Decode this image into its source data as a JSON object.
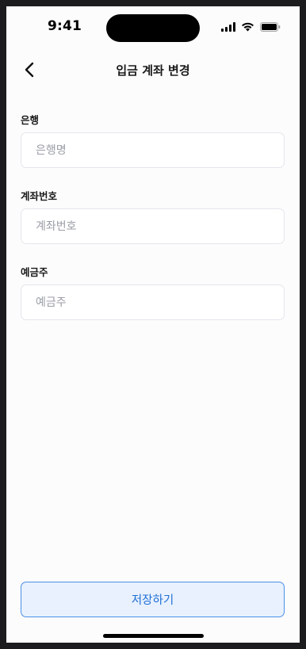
{
  "status_bar": {
    "time": "9:41",
    "icons": [
      "signal-icon",
      "wifi-icon",
      "battery-icon"
    ]
  },
  "header": {
    "back_icon": "chevron-left-icon",
    "title": "입금 계좌 변경"
  },
  "form": {
    "bank": {
      "label": "은행",
      "placeholder": "은행명",
      "value": ""
    },
    "account_number": {
      "label": "계좌번호",
      "placeholder": "계좌번호",
      "value": ""
    },
    "account_holder": {
      "label": "예금주",
      "placeholder": "예금주",
      "value": ""
    }
  },
  "save_button": {
    "label": "저장하기"
  },
  "colors": {
    "accent": "#1f6fd6",
    "accent_border": "#4c8fe6",
    "accent_bg": "#e8f1fd",
    "input_border": "#e4e6ea",
    "placeholder": "#9a9ea6"
  }
}
